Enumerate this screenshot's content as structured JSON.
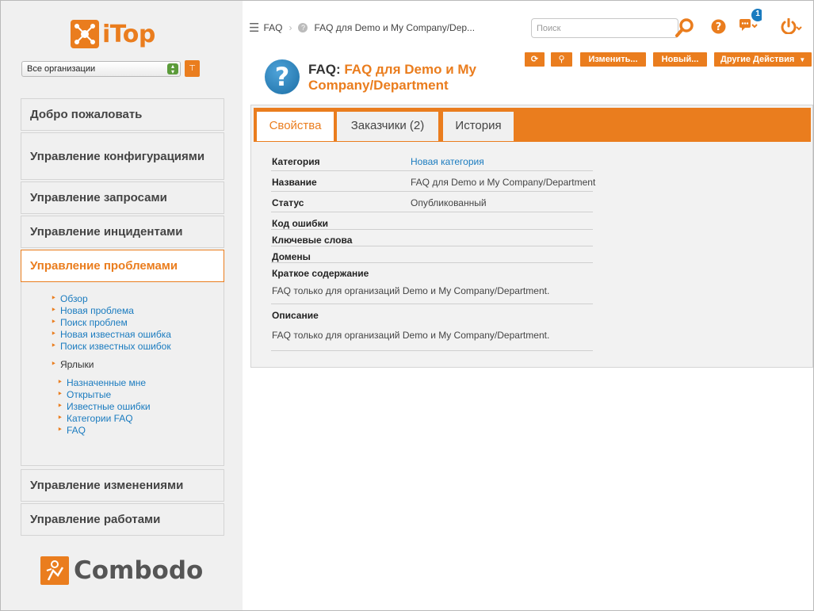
{
  "app": {
    "logo_text": "iTop",
    "footer_logo_text": "Combodo"
  },
  "org_select": {
    "value": "Все организации"
  },
  "menus": {
    "welcome": "Добро пожаловать",
    "config": "Управление конфигурациями",
    "requests": "Управление запросами",
    "incidents": "Управление инцидентами",
    "problems": "Управление проблемами",
    "changes": "Управление изменениями",
    "works": "Управление работами"
  },
  "problems_submenu": {
    "items": [
      "Обзор",
      "Новая проблема",
      "Поиск проблем",
      "Новая известная ошибка",
      "Поиск известных ошибок"
    ],
    "shortcuts_label": "Ярлыки",
    "shortcuts": [
      "Назначенные мне",
      "Открытые",
      "Известные ошибки",
      "Категории FAQ",
      "FAQ"
    ]
  },
  "breadcrumb": {
    "first": "FAQ",
    "second": "FAQ для Demo и My Company/Dep..."
  },
  "search": {
    "placeholder": "Поиск"
  },
  "notifications": {
    "count": "1"
  },
  "object": {
    "class_label": "FAQ:",
    "name": "FAQ для Demo и My Company/Department"
  },
  "actions": {
    "modify": "Изменить...",
    "new": "Новый...",
    "other": "Другие Действия"
  },
  "tabs": [
    "Свойства",
    "Заказчики (2)",
    "История"
  ],
  "fields": {
    "category_label": "Категория",
    "category_value": "Новая категория",
    "title_label": "Название",
    "title_value": "FAQ для Demo и My Company/Department",
    "status_label": "Статус",
    "status_value": "Опубликованный",
    "error_code_label": "Код ошибки",
    "keywords_label": "Ключевые слова",
    "domains_label": "Домены",
    "summary_label": "Краткое содержание",
    "summary_value": "FAQ только для организаций Demo и My Company/Department.",
    "description_label": "Описание",
    "description_value": "FAQ только для организаций Demo и My Company/Department."
  },
  "colors": {
    "accent": "#ea7d1e",
    "link": "#1a7bbf",
    "panel": "#f2f2f2",
    "sidebar": "#f0f0f0"
  },
  "icons": [
    "itop-logo-icon",
    "org-select-arrows-icon",
    "org-tree-icon",
    "list-icon",
    "chevron-right-icon",
    "help-circle-icon",
    "search-icon",
    "help-icon",
    "notifications-icon",
    "power-icon",
    "refresh-icon",
    "question-icon",
    "combodo-logo-icon"
  ]
}
